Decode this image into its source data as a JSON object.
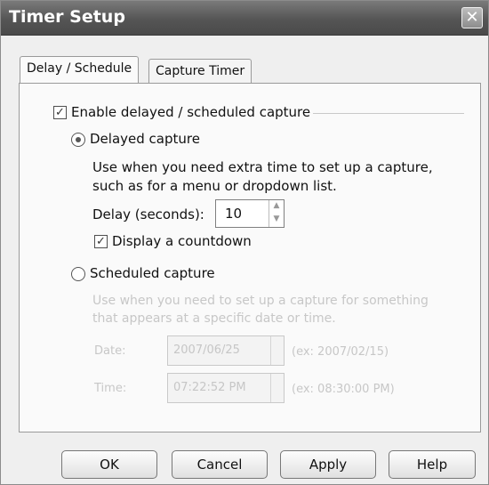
{
  "window": {
    "title": "Timer Setup"
  },
  "tabs": [
    {
      "label": "Delay / Schedule",
      "active": true
    },
    {
      "label": "Capture Timer",
      "active": false
    }
  ],
  "delay_schedule": {
    "enable_label": "Enable delayed / scheduled capture",
    "enable_checked": true,
    "delayed": {
      "label": "Delayed capture",
      "selected": true,
      "desc_line1": "Use when you need extra time to set up a capture,",
      "desc_line2": "such as for a menu or dropdown list.",
      "delay_label": "Delay (seconds):",
      "delay_value": "10",
      "countdown_label": "Display a countdown",
      "countdown_checked": true
    },
    "scheduled": {
      "label": "Scheduled capture",
      "selected": false,
      "desc_line1": "Use when you need to set up a capture for something",
      "desc_line2": "that appears at a specific date or time.",
      "date_label": "Date:",
      "date_value": "2007/06/25",
      "date_hint": "(ex: 2007/02/15)",
      "time_label": "Time:",
      "time_value": "07:22:52 PM",
      "time_hint": "(ex: 08:30:00 PM)"
    }
  },
  "buttons": {
    "ok": "OK",
    "cancel": "Cancel",
    "apply": "Apply",
    "help": "Help"
  },
  "icons": {
    "close": "close-icon",
    "check": "check-icon",
    "spin_up": "chevron-up-icon",
    "spin_down": "chevron-down-icon"
  }
}
